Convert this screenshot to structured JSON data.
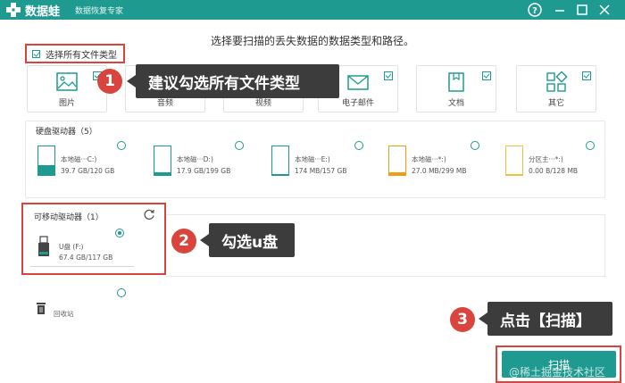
{
  "titlebar": {
    "brand": "数据蛙",
    "subtitle": "数据恢复专家"
  },
  "instruction": "选择要扫描的丢失数据的数据类型和路径。",
  "select_all": {
    "label": "选择所有文件类型"
  },
  "types": [
    {
      "label": "图片",
      "icon": "image-icon"
    },
    {
      "label": "音频",
      "icon": "audio-icon"
    },
    {
      "label": "视频",
      "icon": "video-icon"
    },
    {
      "label": "电子邮件",
      "icon": "email-icon"
    },
    {
      "label": "文档",
      "icon": "document-icon"
    },
    {
      "label": "其它",
      "icon": "other-icon"
    }
  ],
  "callouts": [
    {
      "num": "1",
      "text": "建议勾选所有文件类型"
    },
    {
      "num": "2",
      "text": "勾选u盘"
    },
    {
      "num": "3",
      "text": "点击【扫描】"
    }
  ],
  "hdd": {
    "title": "硬盘驱动器（5）",
    "drives": [
      {
        "name": "本地磁···C:)",
        "size": "39.7 GB/120 GB",
        "fill_fraction": 0.33,
        "fill_color": "#1f9a91"
      },
      {
        "name": "本地磁···D:)",
        "size": "17.9 GB/199 GB",
        "fill_fraction": 0.09,
        "fill_color": "#1f9a91"
      },
      {
        "name": "本地磁···E:)",
        "size": "174 MB/157 GB",
        "fill_fraction": 0.0,
        "fill_color": "#1f9a91"
      },
      {
        "name": "本地磁···*:)",
        "size": "27.0 MB/299 MB",
        "fill_fraction": 0.09,
        "fill_color": "#f39c12"
      },
      {
        "name": "分区主···*:)",
        "size": "0.00  B/128 MB",
        "fill_fraction": 0.0,
        "fill_color": "#f0c040"
      }
    ]
  },
  "removable": {
    "title": "可移动驱动器（1）",
    "drive": {
      "name": "U盘 (F:)",
      "size": "67.4 GB/117 GB"
    }
  },
  "recycle": {
    "label": "回收站"
  },
  "scan": {
    "label": "扫描"
  },
  "watermark": "@稀土掘金技术社区",
  "colors": {
    "accent": "#1f9a91",
    "highlight": "#d9443d",
    "callout_bg": "#3c3c3c"
  }
}
